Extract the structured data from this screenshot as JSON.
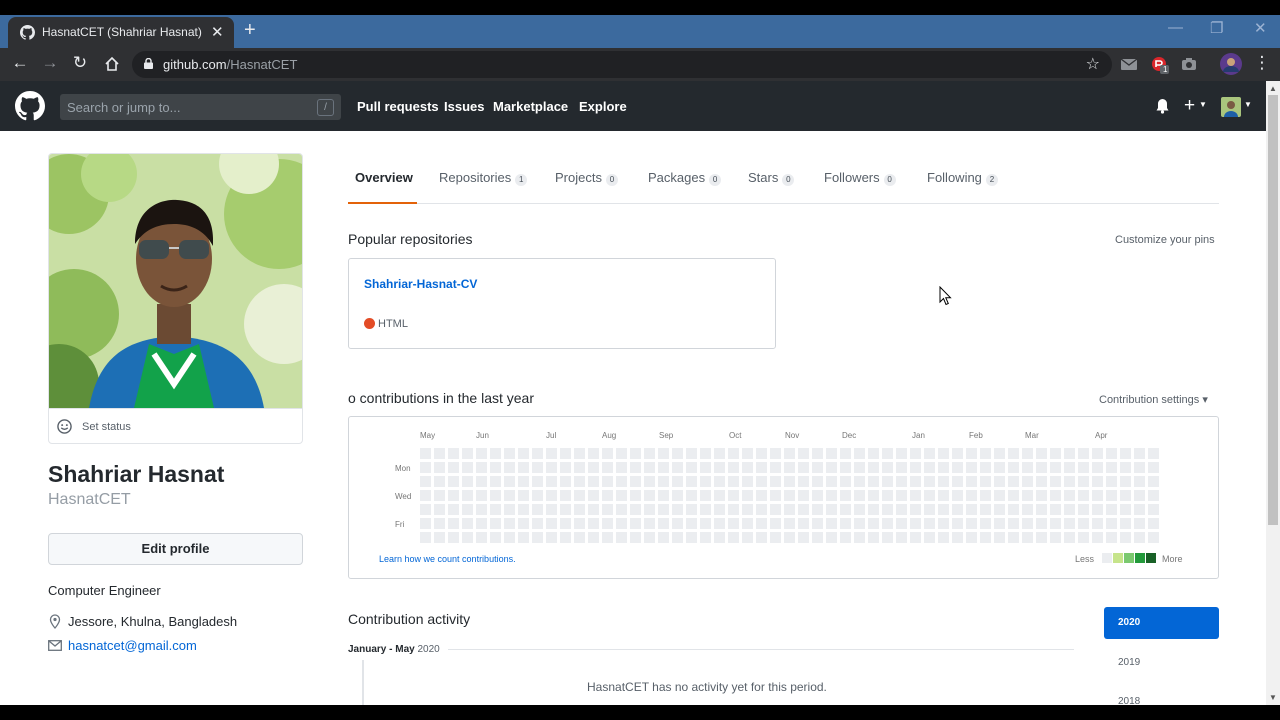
{
  "browser": {
    "tab_title": "HasnatCET (Shahriar Hasnat)",
    "url_host": "github.com",
    "url_path": "/HasnatCET",
    "extension_badge": "1"
  },
  "gh_header": {
    "search_placeholder": "Search or jump to...",
    "search_shortcut": "/",
    "nav": [
      "Pull requests",
      "Issues",
      "Marketplace",
      "Explore"
    ]
  },
  "profile": {
    "set_status": "Set status",
    "name": "Shahriar Hasnat",
    "login": "HasnatCET",
    "edit_profile": "Edit profile",
    "bio": "Computer Engineer",
    "location": "Jessore, Khulna, Bangladesh",
    "email": "hasnatcet@gmail.com"
  },
  "tabs": [
    {
      "label": "Overview",
      "count": ""
    },
    {
      "label": "Repositories",
      "count": "1"
    },
    {
      "label": "Projects",
      "count": "0"
    },
    {
      "label": "Packages",
      "count": "0"
    },
    {
      "label": "Stars",
      "count": "0"
    },
    {
      "label": "Followers",
      "count": "0"
    },
    {
      "label": "Following",
      "count": "2"
    }
  ],
  "popular": {
    "heading": "Popular repositories",
    "customize": "Customize your pins",
    "repo_name": "Shahriar-Hasnat-CV",
    "repo_language": "HTML",
    "language_color": "#e34c26"
  },
  "contributions": {
    "heading": "o contributions in the last year",
    "settings": "Contribution settings ▾",
    "months": [
      "May",
      "Jun",
      "Jul",
      "Aug",
      "Sep",
      "Oct",
      "Nov",
      "Dec",
      "Jan",
      "Feb",
      "Mar",
      "Apr"
    ],
    "days": [
      "Mon",
      "Wed",
      "Fri"
    ],
    "learn": "Learn how we count contributions.",
    "less": "Less",
    "more": "More",
    "scale_colors": [
      "#ebedf0",
      "#c6e48b",
      "#7bc96f",
      "#239a3b",
      "#196127"
    ]
  },
  "activity": {
    "heading": "Contribution activity",
    "period": "January - May",
    "period_year": "2020",
    "no_activity": "HasnatCET has no activity yet for this period.",
    "years": [
      "2020",
      "2019",
      "2018"
    ]
  }
}
